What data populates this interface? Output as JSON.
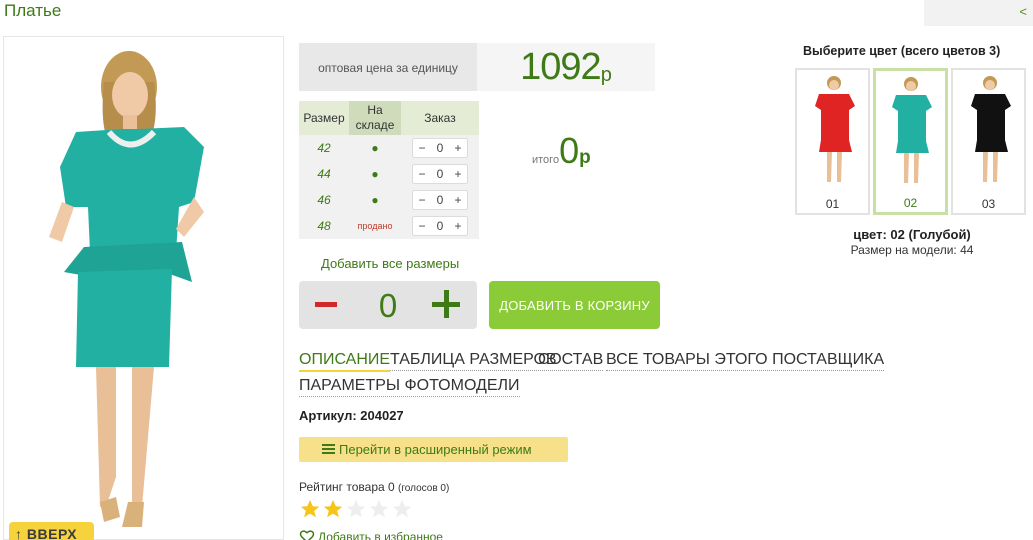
{
  "title": "Платье",
  "collapse_symbol": "<",
  "up_button": "↑ ВВЕРХ",
  "price": {
    "label": "оптовая цена за единицу",
    "value": "1092",
    "currency": "р"
  },
  "size_table": {
    "headers": [
      "Размер",
      "На складе",
      "Заказ"
    ],
    "rows": [
      {
        "size": "42",
        "stock": "●",
        "qty": "0"
      },
      {
        "size": "44",
        "stock": "●",
        "qty": "0"
      },
      {
        "size": "46",
        "stock": "●",
        "qty": "0"
      },
      {
        "size": "48",
        "stock": "продано",
        "qty": "0"
      }
    ],
    "minus": "−",
    "plus": "+"
  },
  "total": {
    "label": "итого",
    "value": "0",
    "currency": "р"
  },
  "add_all_sizes": "Добавить все размеры",
  "quantity": "0",
  "add_to_cart": "ДОБАВИТЬ В КОРЗИНУ",
  "tabs": [
    "ОПИСАНИЕ",
    "ТАБЛИЦА РАЗМЕРОВ",
    "СОСТАВ",
    "ВСЕ ТОВАРЫ ЭТОГО ПОСТАВЩИКА",
    "ПАРАМЕТРЫ ФОТОМОДЕЛИ"
  ],
  "article": "Артикул: 204027",
  "extended_mode": "Перейти в расширенный режим",
  "rating": {
    "text": "Рейтинг товара 0",
    "votes": "(голосов 0)",
    "stars_filled": 2,
    "stars_total": 5
  },
  "favorites": "Добавить в избранное",
  "colors": {
    "title": "Выберите цвет (всего цветов 3)",
    "items": [
      {
        "code": "01",
        "color": "#e02424"
      },
      {
        "code": "02",
        "color": "#22b0a2"
      },
      {
        "code": "03",
        "color": "#111111"
      }
    ],
    "selected_index": 1,
    "selected_text": "цвет: 02 (Голубой)",
    "model_size": "Размер на модели: 44"
  },
  "colors_accent": {
    "green": "#3e7a16",
    "cart": "#8ccb38",
    "yellow": "#f6d33c"
  },
  "icons": [
    "list-icon",
    "heart-icon",
    "star-icon",
    "arrow-up-icon"
  ]
}
